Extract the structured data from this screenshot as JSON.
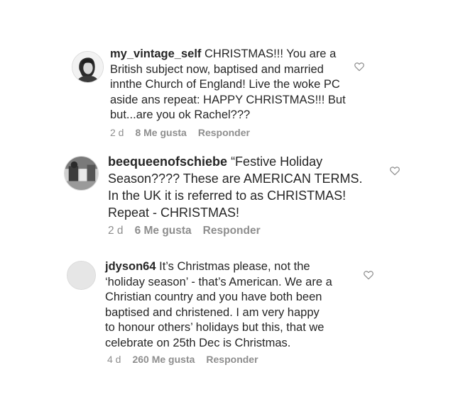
{
  "comments": [
    {
      "username": "my_vintage_self",
      "text": "CHRISTMAS!!! You are a\nBritish subject now, baptised and married\ninnthe Church of England! Live the woke PC\naside ans repeat: HAPPY CHRISTMAS!!! But\nbut...are you ok Rachel???",
      "age": "2 d",
      "likes": "8 Me gusta",
      "reply": "Responder",
      "avatar_icon": "user-photo-avatar",
      "like_icon": "heart-outline-icon"
    },
    {
      "username": "beequeenofschiebe",
      "text": "“Festive Holiday\nSeason???? These are AMERICAN TERMS.\nIn the UK it is referred to as CHRISTMAS!\nRepeat - CHRISTMAS!",
      "age": "2 d",
      "likes": "6 Me gusta",
      "reply": "Responder",
      "avatar_icon": "user-photo-avatar",
      "like_icon": "heart-outline-icon"
    },
    {
      "username": "jdyson64",
      "text": "It’s Christmas please, not the\n‘holiday season’ - that’s American. We are a\nChristian country and you have both been\nbaptised and christened. I am very happy\nto honour others’ holidays but this, that we\ncelebrate on 25th Dec is Christmas.",
      "age": "4 d",
      "likes": "260 Me gusta",
      "reply": "Responder",
      "avatar_icon": "default-avatar",
      "like_icon": "heart-outline-icon"
    }
  ],
  "colors": {
    "text": "#262626",
    "meta": "#8e8e8e",
    "heart": "#8e8e8e"
  }
}
